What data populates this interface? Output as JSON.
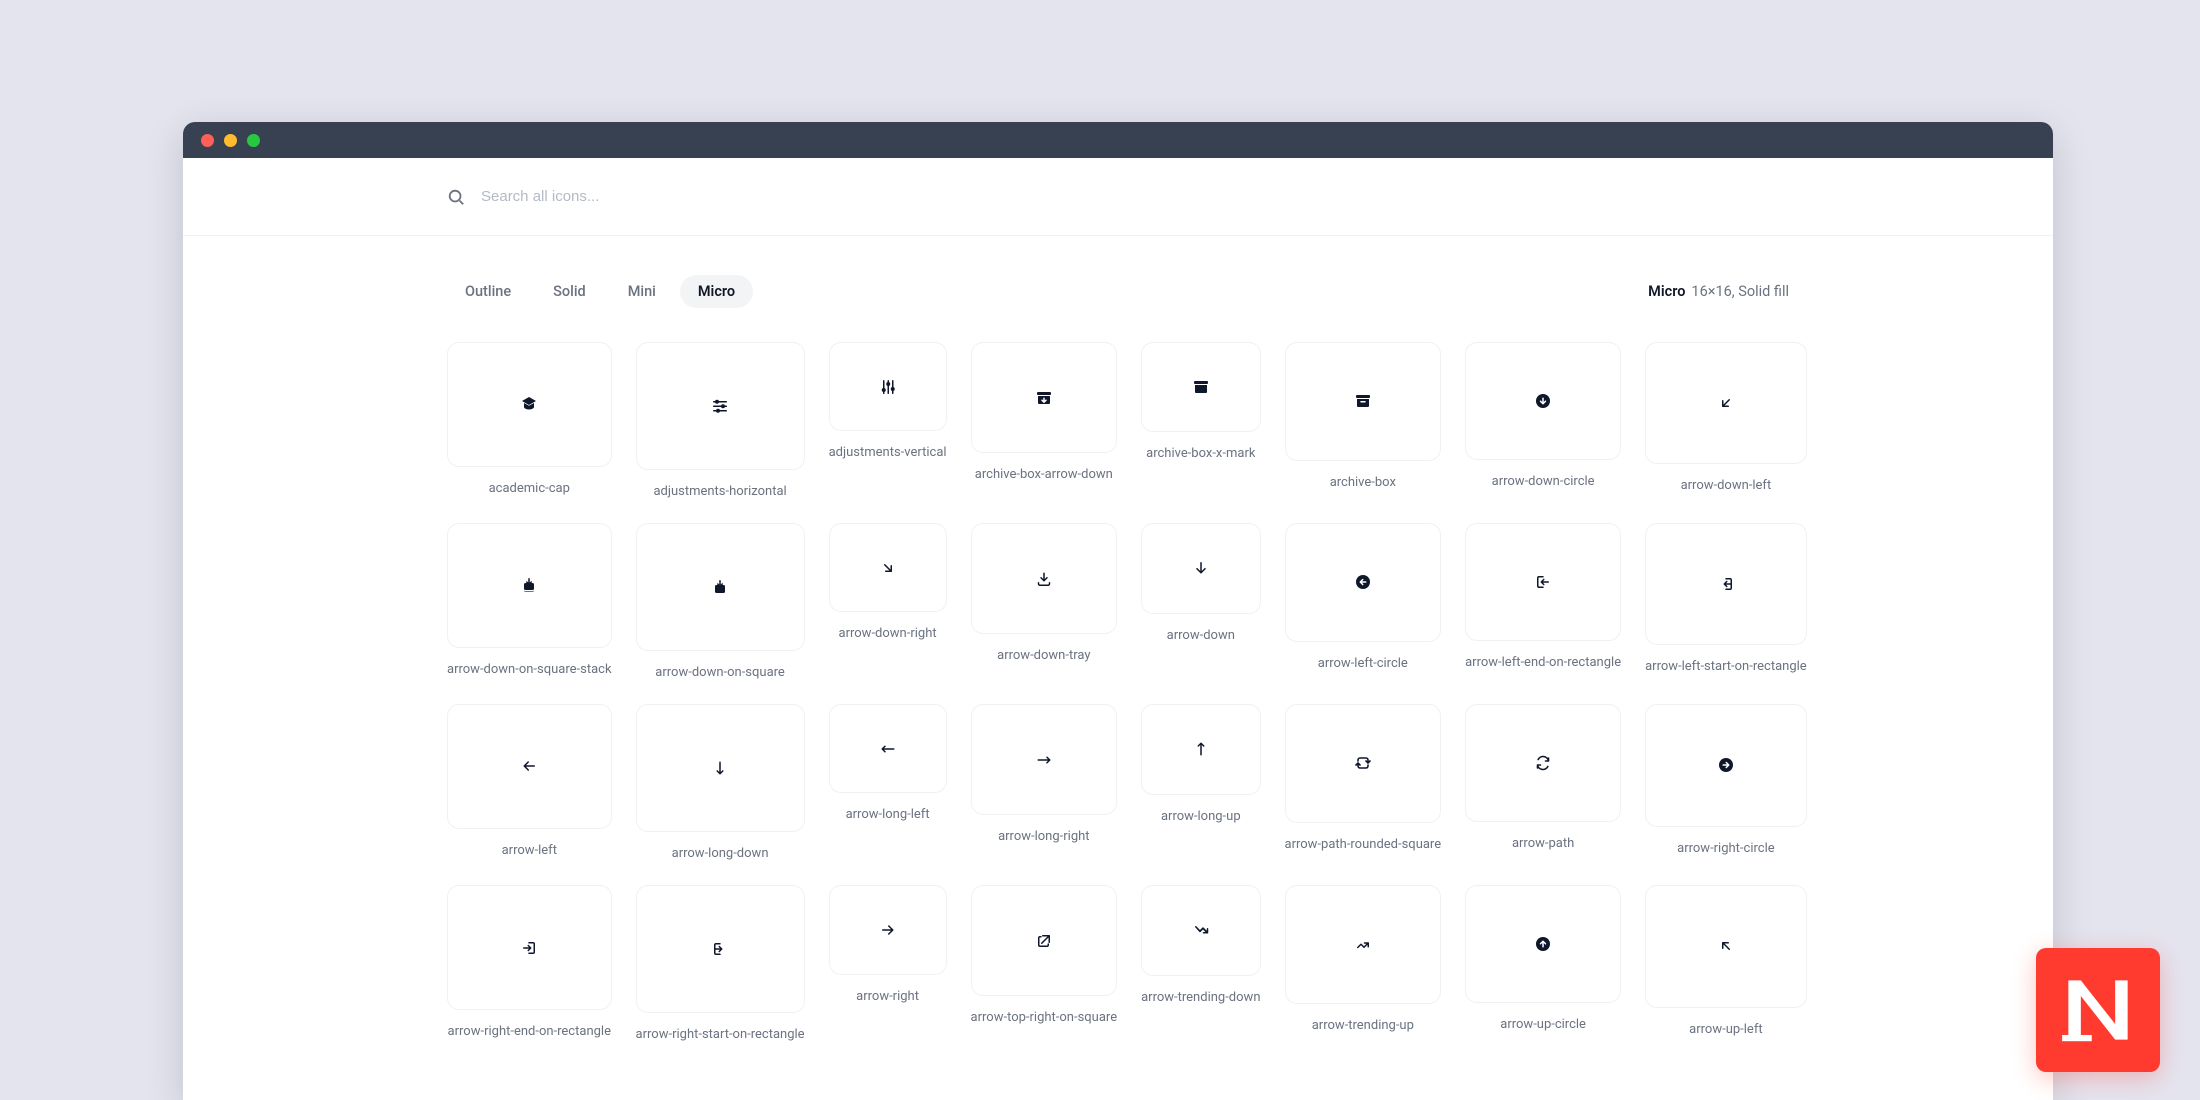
{
  "search": {
    "placeholder": "Search all icons..."
  },
  "tabs": [
    {
      "label": "Outline"
    },
    {
      "label": "Solid"
    },
    {
      "label": "Mini"
    },
    {
      "label": "Micro"
    }
  ],
  "active_tab": 3,
  "meta": {
    "name": "Micro",
    "spec": "16×16, Solid fill"
  },
  "icons": [
    {
      "name": "academic-cap",
      "svg_key": "academic-cap"
    },
    {
      "name": "adjustments-horizontal",
      "svg_key": "adjustments-horizontal"
    },
    {
      "name": "adjustments-vertical",
      "svg_key": "adjustments-vertical"
    },
    {
      "name": "archive-box-arrow-down",
      "svg_key": "archive-box-arrow-down"
    },
    {
      "name": "archive-box-x-mark",
      "svg_key": "archive-box-x-mark"
    },
    {
      "name": "archive-box",
      "svg_key": "archive-box"
    },
    {
      "name": "arrow-down-circle",
      "svg_key": "arrow-down-circle"
    },
    {
      "name": "arrow-down-left",
      "svg_key": "arrow-down-left"
    },
    {
      "name": "arrow-down-on-square-stack",
      "svg_key": "arrow-down-on-square-stack"
    },
    {
      "name": "arrow-down-on-square",
      "svg_key": "arrow-down-on-square"
    },
    {
      "name": "arrow-down-right",
      "svg_key": "arrow-down-right"
    },
    {
      "name": "arrow-down-tray",
      "svg_key": "arrow-down-tray"
    },
    {
      "name": "arrow-down",
      "svg_key": "arrow-down"
    },
    {
      "name": "arrow-left-circle",
      "svg_key": "arrow-left-circle"
    },
    {
      "name": "arrow-left-end-on-rectangle",
      "svg_key": "arrow-left-end-on-rectangle"
    },
    {
      "name": "arrow-left-start-on-rectangle",
      "svg_key": "arrow-left-start-on-rectangle"
    },
    {
      "name": "arrow-left",
      "svg_key": "arrow-left"
    },
    {
      "name": "arrow-long-down",
      "svg_key": "arrow-long-down"
    },
    {
      "name": "arrow-long-left",
      "svg_key": "arrow-long-left"
    },
    {
      "name": "arrow-long-right",
      "svg_key": "arrow-long-right"
    },
    {
      "name": "arrow-long-up",
      "svg_key": "arrow-long-up"
    },
    {
      "name": "arrow-path-rounded-square",
      "svg_key": "arrow-path-rounded-square"
    },
    {
      "name": "arrow-path",
      "svg_key": "arrow-path"
    },
    {
      "name": "arrow-right-circle",
      "svg_key": "arrow-right-circle"
    },
    {
      "name": "arrow-right-end-on-rectangle",
      "svg_key": "arrow-right-end-on-rectangle"
    },
    {
      "name": "arrow-right-start-on-rectangle",
      "svg_key": "arrow-right-start-on-rectangle"
    },
    {
      "name": "arrow-right",
      "svg_key": "arrow-right"
    },
    {
      "name": "arrow-top-right-on-square",
      "svg_key": "arrow-top-right-on-square"
    },
    {
      "name": "arrow-trending-down",
      "svg_key": "arrow-trending-down"
    },
    {
      "name": "arrow-trending-up",
      "svg_key": "arrow-trending-up"
    },
    {
      "name": "arrow-up-circle",
      "svg_key": "arrow-up-circle"
    },
    {
      "name": "arrow-up-left",
      "svg_key": "arrow-up-left"
    }
  ]
}
